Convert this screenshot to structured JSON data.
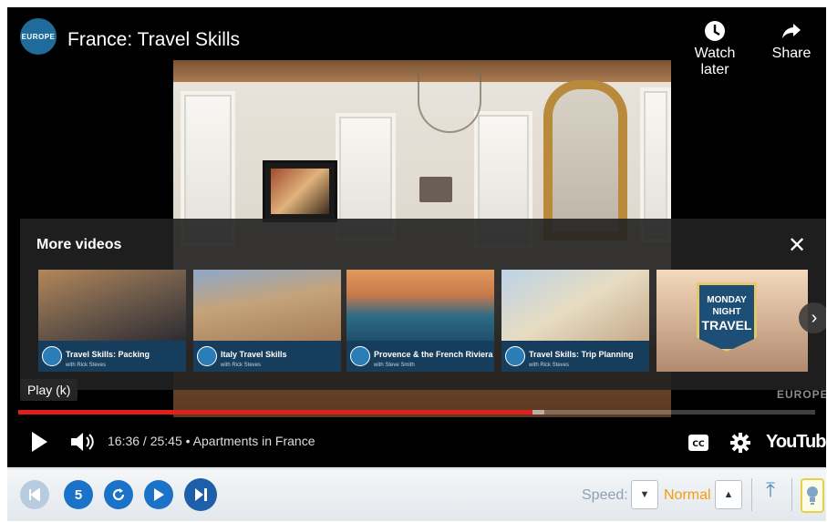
{
  "player": {
    "channel_logo_text": "EUROPE",
    "title": "France: Travel Skills",
    "watch_later_label": "Watch later",
    "share_label": "Share",
    "tooltip": "Play (k)",
    "watermark": "EUROPE",
    "time": "16:36 / 25:45",
    "chapter": "• Apartments in France",
    "youtube_label": "YouTube",
    "progress_fraction": 0.645
  },
  "more_videos": {
    "heading": "More videos",
    "close_label": "✕",
    "items": [
      {
        "title": "Travel Skills: Packing",
        "subtitle": "with Rick Steves"
      },
      {
        "title": "Italy Travel Skills",
        "subtitle": "with Rick Steves"
      },
      {
        "title": "Provence & the French Riviera",
        "subtitle": "with Steve Smith"
      },
      {
        "title": "Travel Skills: Trip Planning",
        "subtitle": "with Rick Steves"
      },
      {
        "title": "MONDAY NIGHT TRAVEL",
        "line1": "MONDAY",
        "line2": "NIGHT",
        "line3": "TRAVEL"
      }
    ],
    "next_label": "›"
  },
  "toolbar": {
    "speed_label": "Speed:",
    "speed_value": "Normal",
    "down_arrow": "▼",
    "up_arrow": "▲",
    "to_top_glyph": "⤒",
    "back5_label": "5"
  },
  "colors": {
    "progress": "#e01e1e",
    "accent": "#1a73c8",
    "speed_value": "#f39c12"
  }
}
